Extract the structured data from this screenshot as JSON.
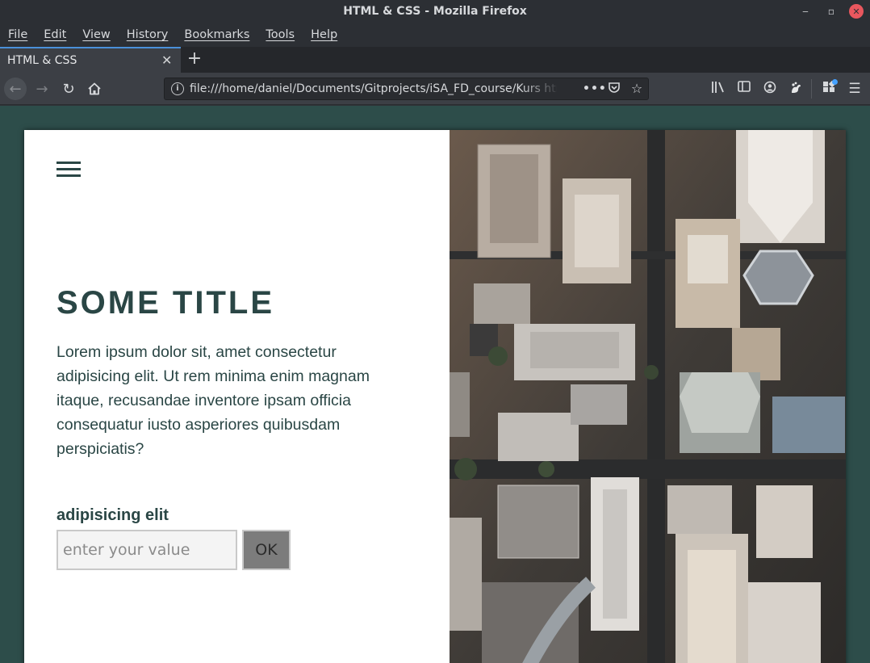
{
  "window": {
    "title": "HTML & CSS - Mozilla Firefox",
    "minimize_icon": "minimize-icon",
    "maximize_icon": "maximize-icon",
    "close_icon": "close-icon"
  },
  "menubar": {
    "items": [
      {
        "label": "File"
      },
      {
        "label": "Edit"
      },
      {
        "label": "View"
      },
      {
        "label": "History"
      },
      {
        "label": "Bookmarks"
      },
      {
        "label": "Tools"
      },
      {
        "label": "Help"
      }
    ]
  },
  "tabs": [
    {
      "label": "HTML & CSS",
      "active": true
    }
  ],
  "navbar": {
    "url": "file:///home/daniel/Documents/Gitprojects/iSA_FD_course/Kurs htm",
    "accent": "#4a90d9"
  },
  "page": {
    "title": "SOME TITLE",
    "lead": "Lorem ipsum dolor sit, amet consectetur adipisicing elit. Ut rem minima enim magnam itaque, recusandae inventore ipsam officia consequatur iusto asperiores quibusdam perspiciatis?",
    "form": {
      "label": "adipisicing elit",
      "placeholder": "enter your value",
      "button_label": "OK"
    },
    "colors": {
      "background": "#2d4d4a",
      "text": "#2a4645",
      "card": "#ffffff"
    }
  }
}
